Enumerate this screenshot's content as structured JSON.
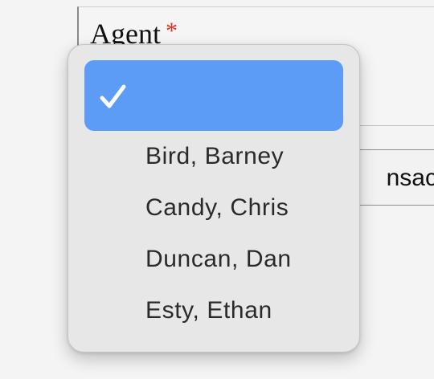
{
  "form": {
    "field_label": "Agent",
    "required_mark": "*",
    "button_partial_text": "nsacti"
  },
  "dropdown": {
    "selected_label": "",
    "options": [
      {
        "label": "Bird, Barney"
      },
      {
        "label": "Candy, Chris"
      },
      {
        "label": "Duncan, Dan"
      },
      {
        "label": "Esty, Ethan"
      }
    ]
  },
  "colors": {
    "selected_highlight": "#5c9cf7",
    "required_mark": "#e0301e",
    "popup_background": "#e7e7e7"
  },
  "icons": {
    "selected_indicator": "check-icon"
  }
}
